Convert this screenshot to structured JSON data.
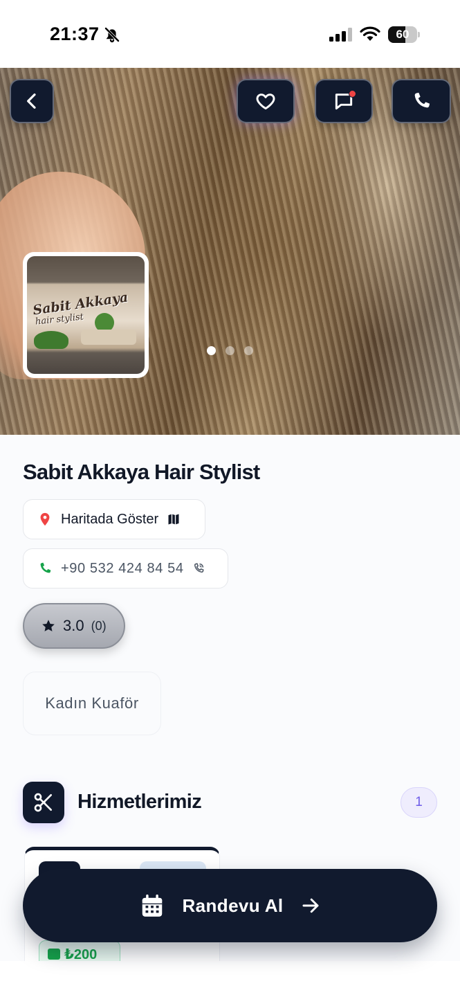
{
  "status_bar": {
    "time": "21:37",
    "battery": "60",
    "battery_level": 0.6,
    "icons": [
      "bell-off-icon",
      "signal-icon",
      "wifi-icon",
      "battery-icon"
    ]
  },
  "hero": {
    "actions": [
      "back-icon",
      "heart-icon",
      "message-icon",
      "phone-icon"
    ],
    "has_message_notification": true,
    "thumbnail": {
      "logo_text": "Sabit Akkaya",
      "logo_sub": "hair stylist"
    },
    "carousel": {
      "count": 3,
      "active_index": 0
    }
  },
  "business": {
    "name": "Sabit Akkaya Hair Stylist",
    "map_label": "Haritada Göster",
    "phone": "+90 532 424 84 54",
    "rating": "3.0",
    "rating_count": "(0)",
    "category": "Kadın Kuaför"
  },
  "services": {
    "title": "Hizmetlerimiz",
    "count": "1",
    "first_price": "₺200"
  },
  "cta": {
    "label": "Randevu Al"
  },
  "colors": {
    "primary": "#111a2e",
    "accent_purple": "#6d5ce8",
    "map_pin": "#ef4444",
    "phone_green": "#16a34a",
    "star": "#111827"
  }
}
